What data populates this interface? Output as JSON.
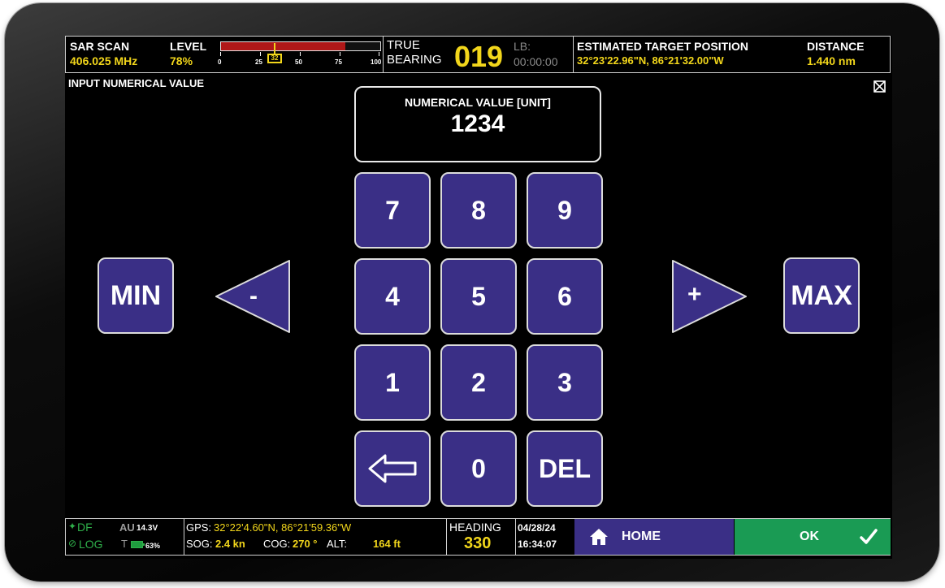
{
  "topbar": {
    "scan_title": "SAR SCAN",
    "frequency": "406.025 MHz",
    "level_label": "LEVEL",
    "level_percent": "78%",
    "level_fraction": 0.78,
    "level_ticks": [
      "0",
      "25",
      "32",
      "50",
      "75",
      "100"
    ],
    "level_marker": "32",
    "true_label": "TRUE",
    "bearing_label": "BEARING",
    "bearing_value": "019",
    "lb_label": "LB:",
    "lb_time": "00:00:00",
    "target_title": "ESTIMATED TARGET POSITION",
    "target_position": "32°23'22.96\"N,  86°21'32.00\"W",
    "distance_title": "DISTANCE",
    "distance_value": "1.440 nm"
  },
  "dialog": {
    "title": "INPUT NUMERICAL VALUE",
    "close_icon": "close-box-icon",
    "value_label": "NUMERICAL VALUE [UNIT]",
    "value": "1234"
  },
  "keypad": {
    "k7": "7",
    "k8": "8",
    "k9": "9",
    "k4": "4",
    "k5": "5",
    "k6": "6",
    "k1": "1",
    "k2": "2",
    "k3": "3",
    "k0": "0",
    "del": "DEL",
    "backspace_icon": "backspace-arrow-icon"
  },
  "controls": {
    "min": "MIN",
    "max": "MAX",
    "minus": "-",
    "plus": "+"
  },
  "bottombar": {
    "df": "DF",
    "log": "LOG",
    "au": "AU",
    "voltage": "14.3V",
    "t": "T",
    "battery": "63%",
    "gps_label": "GPS:",
    "gps_value": "32°22'4.60\"N,  86°21'59.36\"W",
    "sog_label": "SOG:",
    "sog_value": "2.4 kn",
    "cog_label": "COG:",
    "cog_value": "270 °",
    "alt_label": "ALT:",
    "alt_value": "164 ft",
    "heading_label": "HEADING",
    "heading_value": "330",
    "date": "04/28/24",
    "time": "16:34:07",
    "home": "HOME",
    "ok": "OK"
  },
  "colors": {
    "accent_yellow": "#f2d61b",
    "key_blue": "#3a2f86",
    "ok_green": "#1a9b54",
    "level_red": "#b01818"
  }
}
